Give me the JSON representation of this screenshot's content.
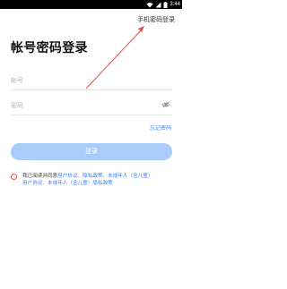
{
  "status_bar": {
    "time": "3:44",
    "icons": [
      "wifi-icon",
      "signal-icon",
      "battery-icon"
    ]
  },
  "header": {
    "switch_link": "手机密码登录"
  },
  "main": {
    "title": "帐号密码登录",
    "account_placeholder": "帐号",
    "password_placeholder": "密码",
    "forgot_link": "忘记密码",
    "login_button": "登录"
  },
  "agreement": {
    "line1_prefix": "我已阅读并同意",
    "line1_links": [
      "用户协议、隐私政策、未成年人（含儿童）"
    ],
    "line2_links": [
      "用户协议、未成年人（含儿童）隐私政策"
    ]
  },
  "annotation": {
    "arrow_color": "#e0524a",
    "icon": "red-arrow-icon"
  },
  "colors": {
    "accent": "#3b82f6",
    "button_disabled": "#a9ccfb",
    "checkbox_border": "#e0524a"
  }
}
